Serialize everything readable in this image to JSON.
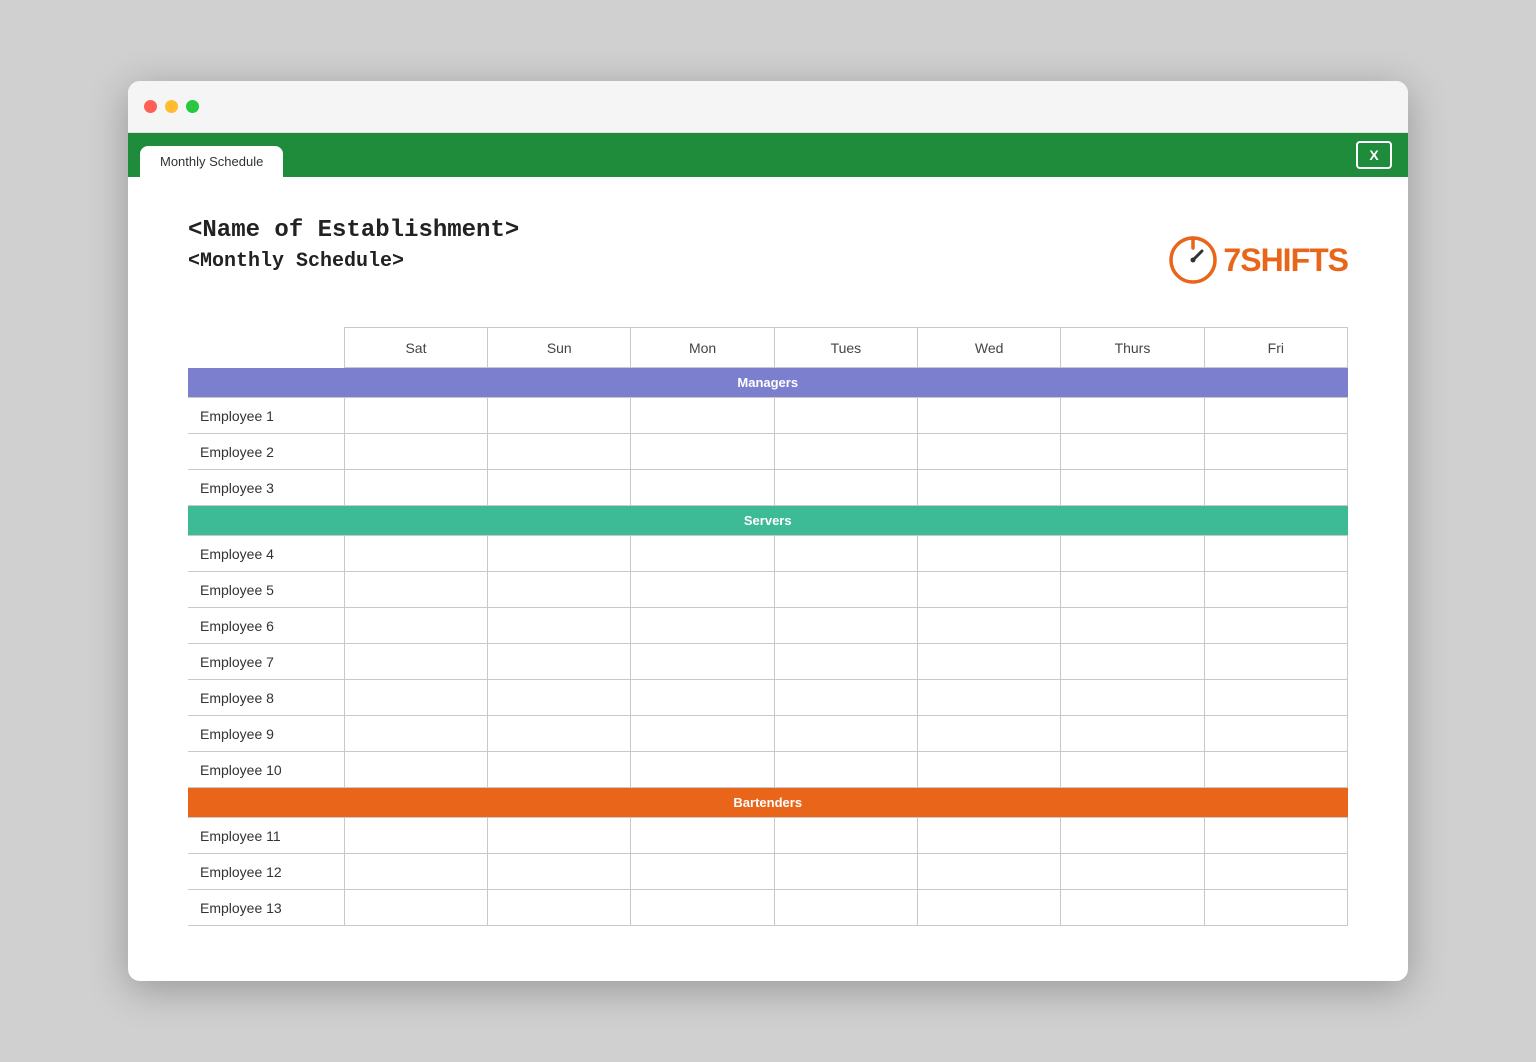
{
  "window": {
    "title": "Monthly Schedule"
  },
  "browser": {
    "tab_label": "",
    "excel_icon": "X"
  },
  "header": {
    "establishment": "<Name of Establishment>",
    "schedule": "<Monthly Schedule>"
  },
  "logo": {
    "brand": "7SHIFTS",
    "number": "7",
    "text": "SHIFTS"
  },
  "table": {
    "days": [
      "Sat",
      "Sun",
      "Mon",
      "Tues",
      "Wed",
      "Thurs",
      "Fri"
    ],
    "sections": [
      {
        "name": "Managers",
        "color": "managers",
        "employees": [
          "Employee 1",
          "Employee 2",
          "Employee 3"
        ]
      },
      {
        "name": "Servers",
        "color": "servers",
        "employees": [
          "Employee 4",
          "Employee 5",
          "Employee 6",
          "Employee 7",
          "Employee 8",
          "Employee 9",
          "Employee 10"
        ]
      },
      {
        "name": "Bartenders",
        "color": "bartenders",
        "employees": [
          "Employee 11",
          "Employee 12",
          "Employee 13"
        ]
      }
    ]
  }
}
